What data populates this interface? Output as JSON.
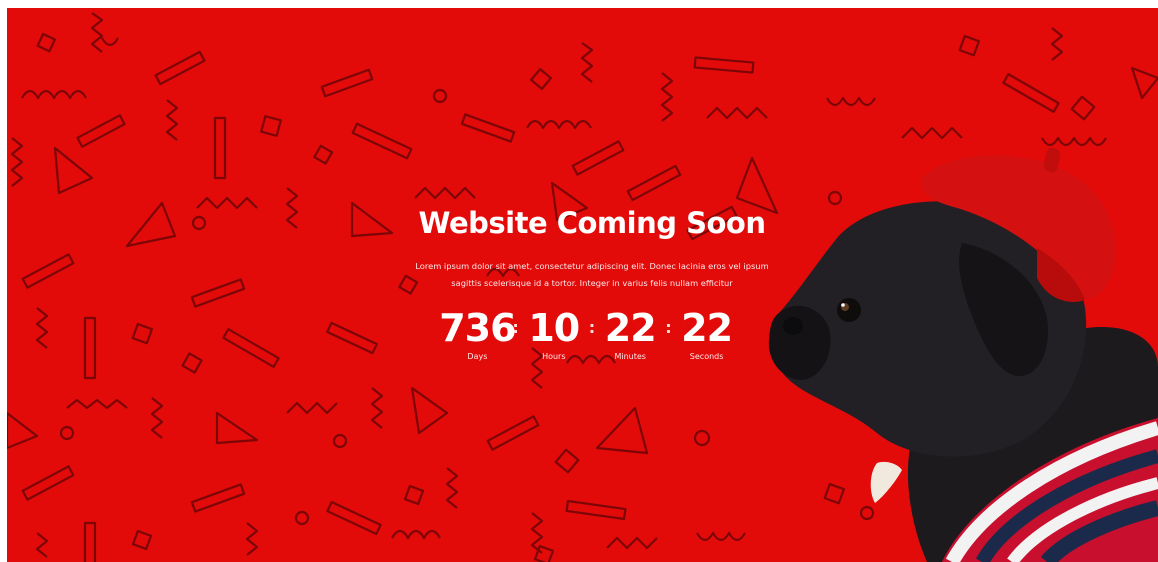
{
  "hero": {
    "title": "Website Coming Soon",
    "description_line1": "Lorem ipsum dolor sit amet, consectetur adipiscing elit. Donec lacinia eros vel ipsum",
    "description_line2": "sagittis scelerisque id a tortor. Integer in varius felis nullam efficitur"
  },
  "countdown": {
    "days": {
      "value": "736",
      "label": "Days"
    },
    "hours": {
      "value": "10",
      "label": "Hours"
    },
    "minutes": {
      "value": "22",
      "label": "Minutes"
    },
    "seconds": {
      "value": "22",
      "label": "Seconds"
    },
    "separator": ":"
  },
  "colors": {
    "background": "#e30a0a",
    "text": "#ffffff",
    "pattern": "#3b0303"
  }
}
